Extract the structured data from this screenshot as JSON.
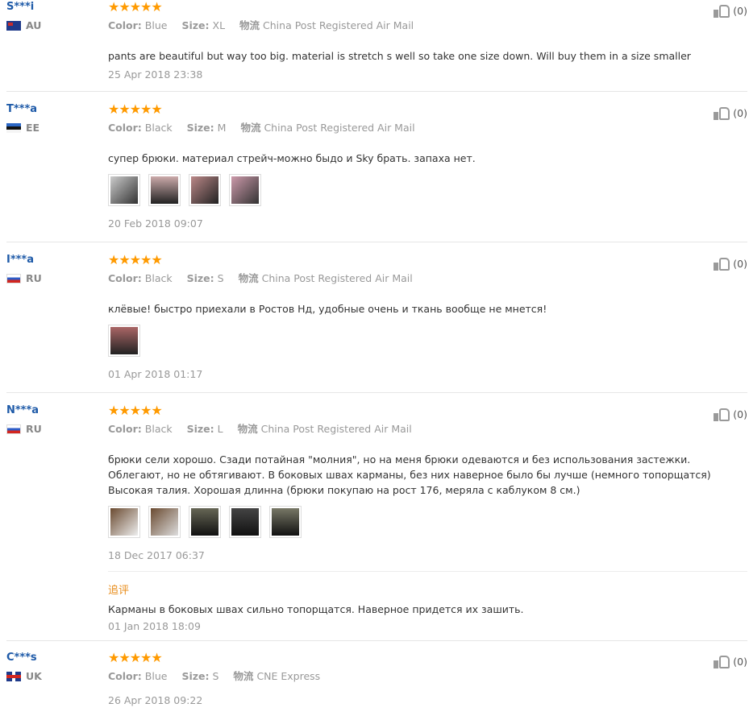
{
  "reviews": [
    {
      "user": "S***i",
      "country": "AU",
      "stars": "★★★★★",
      "color_label": "Color:",
      "color": "Blue",
      "size_label": "Size:",
      "size": "XL",
      "ship_label": "物流",
      "ship": "China Post Registered Air Mail",
      "text": "pants are beautiful but way too big. material is stretch s well so take one size down. Will buy them in a size smaller",
      "date": "25 Apr 2018 23:38",
      "likes": "(0)"
    },
    {
      "user": "T***a",
      "country": "EE",
      "stars": "★★★★★",
      "color_label": "Color:",
      "color": "Black",
      "size_label": "Size:",
      "size": "M",
      "ship_label": "物流",
      "ship": "China Post Registered Air Mail",
      "text": "супер брюки. материал стрейч-можно быдо и Sky брать. запаха нет.",
      "date": "20 Feb 2018 09:07",
      "likes": "(0)"
    },
    {
      "user": "I***a",
      "country": "RU",
      "stars": "★★★★★",
      "color_label": "Color:",
      "color": "Black",
      "size_label": "Size:",
      "size": "S",
      "ship_label": "物流",
      "ship": "China Post Registered Air Mail",
      "text": "клёвые! быстро приехали в Ростов Нд, удобные очень и ткань вообще не мнется!",
      "date": "01 Apr 2018 01:17",
      "likes": "(0)"
    },
    {
      "user": "N***a",
      "country": "RU",
      "stars": "★★★★★",
      "color_label": "Color:",
      "color": "Black",
      "size_label": "Size:",
      "size": "L",
      "ship_label": "物流",
      "ship": "China Post Registered Air Mail",
      "text": "брюки сели хорошо. Сзади потайная \"молния\", но на меня брюки одеваются и без использования застежки. Облегают, но не обтягивают. В боковых швах карманы, без них наверное было бы лучше (немного топорщатся) Высокая талия. Хорошая длинна (брюки покупаю на рост 176, меряла с каблуком 8 см.)",
      "date": "18 Dec 2017 06:37",
      "likes": "(0)",
      "append_title": "追评",
      "append_text": "Карманы в боковых швах сильно топорщатся. Наверное придется их зашить.",
      "append_date": "01 Jan 2018 18:09"
    },
    {
      "user": "C***s",
      "country": "UK",
      "stars": "★★★★★",
      "color_label": "Color:",
      "color": "Blue",
      "size_label": "Size:",
      "size": "S",
      "ship_label": "物流",
      "ship": "CNE Express",
      "date": "26 Apr 2018 09:22",
      "likes": "(0)"
    }
  ]
}
